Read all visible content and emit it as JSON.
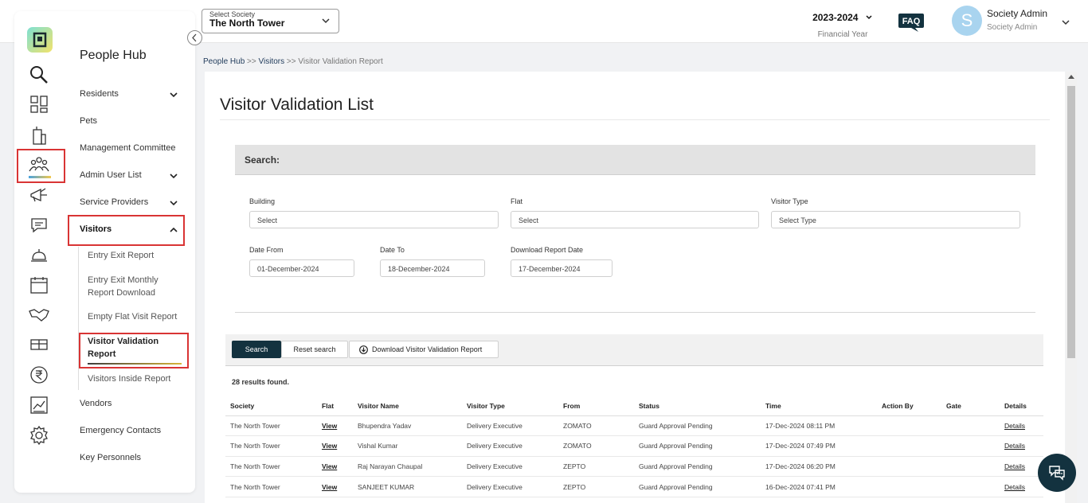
{
  "header": {
    "society_select_label": "Select Society",
    "society_select_value": "The North Tower",
    "financial_year": "2023-2024",
    "financial_year_label": "Financial Year",
    "faq_label": "FAQ",
    "avatar_initial": "S",
    "user_name": "Society Admin",
    "user_role": "Society Admin"
  },
  "rail": {
    "icons": [
      "logo-icon",
      "search-icon",
      "dashboard-icon",
      "building-icon",
      "people-icon",
      "megaphone-icon",
      "chat-icon",
      "service-bell-icon",
      "calendar-icon",
      "handshake-icon",
      "package-icon",
      "rupee-icon",
      "chart-icon",
      "gear-icon"
    ],
    "active": "people-icon"
  },
  "sidebar": {
    "title": "People Hub",
    "items": [
      {
        "label": "Residents",
        "has_chevron": true
      },
      {
        "label": "Pets",
        "has_chevron": false
      },
      {
        "label": "Management Committee",
        "has_chevron": false
      },
      {
        "label": "Admin User List",
        "has_chevron": true
      },
      {
        "label": "Service Providers",
        "has_chevron": true
      },
      {
        "label": "Visitors",
        "has_chevron": true,
        "expanded": true
      },
      {
        "label": "Vendors",
        "has_chevron": false
      },
      {
        "label": "Emergency Contacts",
        "has_chevron": false
      },
      {
        "label": "Key Personnels",
        "has_chevron": false
      }
    ],
    "visitor_subitems": [
      {
        "label": "Entry Exit Report"
      },
      {
        "label": "Entry Exit Monthly Report Download"
      },
      {
        "label": "Empty Flat Visit Report"
      },
      {
        "label": "Visitor Validation Report",
        "active": true
      },
      {
        "label": "Visitors Inside Report"
      }
    ]
  },
  "breadcrumb": {
    "items": [
      "People Hub",
      "Visitors",
      "Visitor Validation Report"
    ],
    "separator": ">>"
  },
  "page": {
    "title": "Visitor Validation List",
    "search_heading": "Search:",
    "filters": {
      "building_label": "Building",
      "building_value": "Select",
      "flat_label": "Flat",
      "flat_value": "Select",
      "visitor_type_label": "Visitor Type",
      "visitor_type_value": "Select Type",
      "date_from_label": "Date From",
      "date_from_value": "01-December-2024",
      "date_to_label": "Date To",
      "date_to_value": "18-December-2024",
      "download_date_label": "Download Report Date",
      "download_date_value": "17-December-2024"
    },
    "buttons": {
      "search": "Search",
      "reset": "Reset search",
      "download": "Download Visitor Validation Report"
    },
    "results_text": "28 results found."
  },
  "table": {
    "columns": [
      "Society",
      "Flat",
      "Visitor Name",
      "Visitor Type",
      "From",
      "Status",
      "Time",
      "Action By",
      "Gate",
      "Details"
    ],
    "rows": [
      {
        "society": "The North Tower",
        "flat": "View",
        "visitor_name": "Bhupendra Yadav",
        "visitor_type": "Delivery Executive",
        "from": "ZOMATO",
        "status": "Guard Approval Pending",
        "time": "17-Dec-2024 08:11 PM",
        "action_by": "",
        "gate": "",
        "details": "Details"
      },
      {
        "society": "The North Tower",
        "flat": "View",
        "visitor_name": "Vishal Kumar",
        "visitor_type": "Delivery Executive",
        "from": "ZOMATO",
        "status": "Guard Approval Pending",
        "time": "17-Dec-2024 07:49 PM",
        "action_by": "",
        "gate": "",
        "details": "Details"
      },
      {
        "society": "The North Tower",
        "flat": "View",
        "visitor_name": "Raj Narayan Chaupal",
        "visitor_type": "Delivery Executive",
        "from": "ZEPTO",
        "status": "Guard Approval Pending",
        "time": "17-Dec-2024 06:20 PM",
        "action_by": "",
        "gate": "",
        "details": "Details"
      },
      {
        "society": "The North Tower",
        "flat": "View",
        "visitor_name": "SANJEET KUMAR",
        "visitor_type": "Delivery Executive",
        "from": "ZEPTO",
        "status": "Guard Approval Pending",
        "time": "16-Dec-2024 07:41 PM",
        "action_by": "",
        "gate": "",
        "details": "Details"
      }
    ]
  },
  "colors": {
    "primary_dark": "#13323f",
    "highlight_red": "#d93434",
    "avatar_bg": "#a9d4ef"
  }
}
